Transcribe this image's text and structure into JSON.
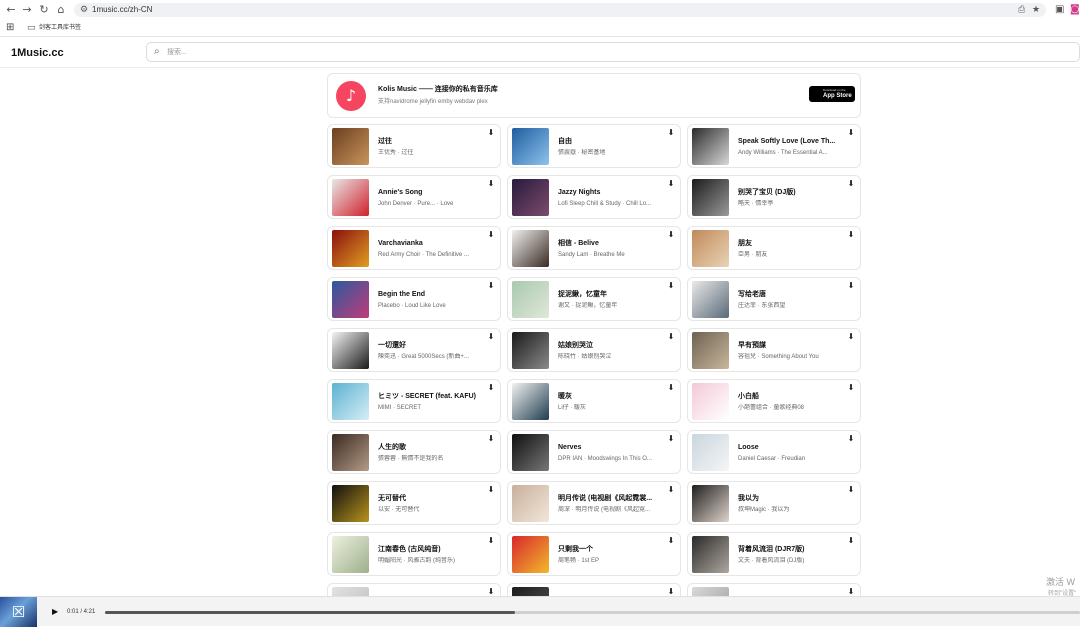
{
  "browser": {
    "url": "1music.cc/zh-CN",
    "bookmark_label": "剑客工具库书签",
    "icons": [
      "back-icon",
      "forward-icon",
      "reload-icon",
      "home-icon",
      "site-info-icon",
      "translate-icon",
      "star-icon",
      "extension-icon",
      "profile-icon",
      "apps-icon",
      "folder-icon"
    ]
  },
  "header": {
    "logo": "1Music.cc",
    "search_placeholder": "搜索..."
  },
  "promo": {
    "title": "Kolis Music —— 连接你的私有音乐库",
    "subtitle": "支持navidrome jellyfin emby webdav plex",
    "appstore_small": "Download on the",
    "appstore_big": "App Store"
  },
  "songs": [
    {
      "title": "过往",
      "sub": "王优秀 · 过往",
      "cover": [
        "#6b3f1f",
        "#c9955d"
      ]
    },
    {
      "title": "自由",
      "sub": "張震嶽 · 秘密基地",
      "cover": [
        "#1f5d9e",
        "#8ec3ee"
      ]
    },
    {
      "title": "Speak Softly Love (Love Th...",
      "sub": "Andy Williams · The Essential A...",
      "cover": [
        "#2b2b2b",
        "#d8d8d8"
      ]
    },
    {
      "title": "Annie's Song",
      "sub": "John Denver · Pure... · Love",
      "cover": [
        "#e8e8e8",
        "#d0202a"
      ]
    },
    {
      "title": "Jazzy Nights",
      "sub": "Lofi Sleep Chill & Study · Chill Lo...",
      "cover": [
        "#281a3c",
        "#7d4b6e"
      ]
    },
    {
      "title": "别哭了宝贝 (DJ版)",
      "sub": "略天 · 情幸亭",
      "cover": [
        "#1b1b1b",
        "#9a9a9a"
      ]
    },
    {
      "title": "Varchavianka",
      "sub": "Red Army Choir · The Definitive ...",
      "cover": [
        "#8b0f0f",
        "#e0a020"
      ]
    },
    {
      "title": "相信 - Belive",
      "sub": "Sandy Lam · Breathe Me",
      "cover": [
        "#f0f0f0",
        "#3a2a22"
      ]
    },
    {
      "title": "朋友",
      "sub": "亞男 · 朋友",
      "cover": [
        "#c08a5a",
        "#e9d3b6"
      ]
    },
    {
      "title": "Begin the End",
      "sub": "Placebo · Loud Like Love",
      "cover": [
        "#2a5a9e",
        "#c23a7a"
      ]
    },
    {
      "title": "捉泥鳅，忆童年",
      "sub": "谢又 · 捉泥鳅，忆童年",
      "cover": [
        "#a9c8b0",
        "#dfe8d7"
      ]
    },
    {
      "title": "写给老唐",
      "sub": "庄达菲 · 东张西望",
      "cover": [
        "#e9e9e9",
        "#5a6a78"
      ]
    },
    {
      "title": "一切還好",
      "sub": "陳奕迅 · Great 5000Secs (新曲+...",
      "cover": [
        "#f4f4f4",
        "#1a1a1a"
      ]
    },
    {
      "title": "姑娘别哭泣",
      "sub": "陈晓竹 · 姑娘别哭泣",
      "cover": [
        "#1a1a1a",
        "#8a8a8a"
      ]
    },
    {
      "title": "早有預謀",
      "sub": "容祖兒 · Something About You",
      "cover": [
        "#6e6252",
        "#c9b79c"
      ]
    },
    {
      "title": "ヒミツ - SECRET (feat. KAFU)",
      "sub": "MIMI · SECRET",
      "cover": [
        "#5bb2d0",
        "#d7eef6"
      ]
    },
    {
      "title": "暖灰",
      "sub": "Li仔 · 暖灰",
      "cover": [
        "#f2f2f2",
        "#1f3d4f"
      ]
    },
    {
      "title": "小白船",
      "sub": "小葩蕾组合 · 童歌经典08",
      "cover": [
        "#f3c9d6",
        "#ffffff"
      ]
    },
    {
      "title": "人生的歌",
      "sub": "張蓉蓉 · 無情不是我的名",
      "cover": [
        "#3a2a22",
        "#b39b87"
      ]
    },
    {
      "title": "Nerves",
      "sub": "DPR IAN · Moodswings In This O...",
      "cover": [
        "#0f0f0f",
        "#777777"
      ]
    },
    {
      "title": "Loose",
      "sub": "Daniel Caesar · Freudian",
      "cover": [
        "#c9d6de",
        "#f5f5f5"
      ]
    },
    {
      "title": "无可替代",
      "sub": "以安 · 无可替代",
      "cover": [
        "#101010",
        "#b8941c"
      ]
    },
    {
      "title": "明月传说 (电视剧《风起霓裳...",
      "sub": "周深 · 明月传说 (电视剧《风起霓...",
      "cover": [
        "#c8b09a",
        "#f2e6da"
      ]
    },
    {
      "title": "我以为",
      "sub": "叔坤Magic · 我以为",
      "cover": [
        "#1e1e1e",
        "#e0d4cc"
      ]
    },
    {
      "title": "江南春色 (古风纯音)",
      "sub": "明媚阳光 · 风雅古韵 (纯音乐)",
      "cover": [
        "#eef0e0",
        "#9cb08a"
      ]
    },
    {
      "title": "只剩我一个",
      "sub": "周笔畅 · 1st EP",
      "cover": [
        "#d8282e",
        "#f2b92a"
      ]
    },
    {
      "title": "背着风流泪 (DJR7版)",
      "sub": "文夫 · 背着风流泪 (DJ版)",
      "cover": [
        "#2a2a2a",
        "#b0a8a0"
      ]
    },
    {
      "title": "",
      "sub": "",
      "cover": [
        "#e2e2e2",
        "#bbbbbb"
      ]
    },
    {
      "title": "",
      "sub": "",
      "cover": [
        "#1c1c1c",
        "#555555"
      ]
    },
    {
      "title": "",
      "sub": "",
      "cover": [
        "#d9d9d9",
        "#9a9a9a"
      ]
    }
  ],
  "player": {
    "time": "0:01 / 4:21",
    "progress_fraction": 0.42,
    "cover_glyph": "☒"
  },
  "watermark": {
    "line1": "激活 W",
    "line2": "转到\"设置\""
  }
}
